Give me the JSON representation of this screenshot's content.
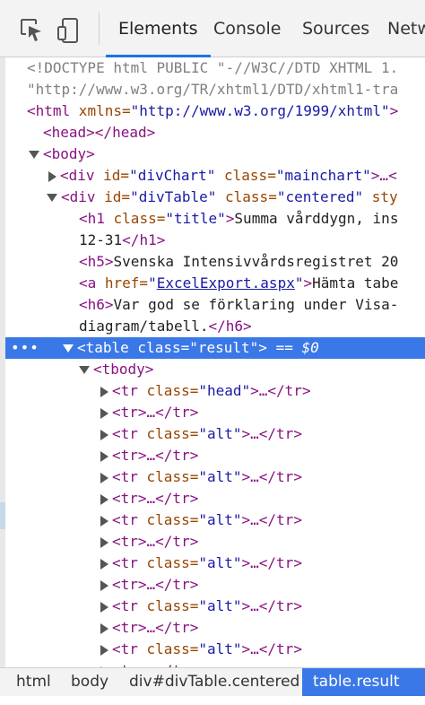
{
  "toolbar": {
    "icons": [
      "select-element-icon",
      "device-toggle-icon"
    ],
    "tabs": [
      {
        "label": "Elements",
        "active": true
      },
      {
        "label": "Console",
        "active": false
      },
      {
        "label": "Sources",
        "active": false
      },
      {
        "label": "Netw",
        "active": false
      }
    ]
  },
  "dom": {
    "doctype_1": "<!DOCTYPE html PUBLIC \"-//W3C//DTD XHTML 1.",
    "doctype_2": "\"http://www.w3.org/TR/xhtml1/DTD/xhtml1-tra",
    "html_open": "<html",
    "html_attr": " xmlns=",
    "html_val": "\"http://www.w3.org/1999/xhtml\"",
    "html_close": ">",
    "head": "<head></head>",
    "body_open": "<body>",
    "div_chart": {
      "tag_open": "<div",
      "attr1": " id=",
      "val1": "\"divChart\"",
      "attr2": " class=",
      "val2": "\"mainchart\"",
      "tail": ">…<"
    },
    "div_table": {
      "tag_open": "<div",
      "attr1": " id=",
      "val1": "\"divTable\"",
      "attr2": " class=",
      "val2": "\"centered\"",
      "tail": " sty"
    },
    "h1": {
      "open": "<h1",
      "attr": " class=",
      "val": "\"title\"",
      "text": "Summa vårddygn, ins",
      "cont": "12-31",
      "close": "</h1>"
    },
    "h5": {
      "open": "<h5>",
      "text": "Svenska Intensivvårdsregistret 20"
    },
    "a": {
      "open": "<a",
      "attr": " href=",
      "link": "ExcelExport.aspx",
      "text": "Hämta tabe"
    },
    "h6": {
      "open": "<h6>",
      "text": "Var god se förklaring under Visa-",
      "cont": "diagram/tabell.",
      "close": "</h6>"
    },
    "selected": {
      "dots": "•••",
      "open": "<table",
      "attr": " class=",
      "val": "\"result\"",
      "close": ">",
      "suffix": " == $0"
    },
    "tbody": "<tbody>",
    "rows": [
      {
        "tag": "<tr",
        "attr": " class=",
        "val": "\"head\"",
        "tail": ">…</tr>"
      },
      {
        "tag": "<tr>",
        "attr": "",
        "val": "",
        "tail": "…</tr>"
      },
      {
        "tag": "<tr",
        "attr": " class=",
        "val": "\"alt\"",
        "tail": ">…</tr>"
      },
      {
        "tag": "<tr>",
        "attr": "",
        "val": "",
        "tail": "…</tr>"
      },
      {
        "tag": "<tr",
        "attr": " class=",
        "val": "\"alt\"",
        "tail": ">…</tr>"
      },
      {
        "tag": "<tr>",
        "attr": "",
        "val": "",
        "tail": "…</tr>"
      },
      {
        "tag": "<tr",
        "attr": " class=",
        "val": "\"alt\"",
        "tail": ">…</tr>"
      },
      {
        "tag": "<tr>",
        "attr": "",
        "val": "",
        "tail": "…</tr>"
      },
      {
        "tag": "<tr",
        "attr": " class=",
        "val": "\"alt\"",
        "tail": ">…</tr>"
      },
      {
        "tag": "<tr>",
        "attr": "",
        "val": "",
        "tail": "…</tr>"
      },
      {
        "tag": "<tr",
        "attr": " class=",
        "val": "\"alt\"",
        "tail": ">…</tr>"
      },
      {
        "tag": "<tr>",
        "attr": "",
        "val": "",
        "tail": "…</tr>"
      },
      {
        "tag": "<tr",
        "attr": " class=",
        "val": "\"alt\"",
        "tail": ">…</tr>"
      },
      {
        "tag": "<tr>",
        "attr": "",
        "val": "",
        "tail": "…</tr>"
      }
    ]
  },
  "breadcrumbs": [
    {
      "label": "html",
      "active": false
    },
    {
      "label": "body",
      "active": false
    },
    {
      "label": "div#divTable.centered",
      "active": false
    },
    {
      "label": "table.result",
      "active": true
    }
  ],
  "colors": {
    "accent": "#3b78e7",
    "tag": "#881280",
    "attr_name": "#994500",
    "attr_value": "#1a1aa6"
  }
}
